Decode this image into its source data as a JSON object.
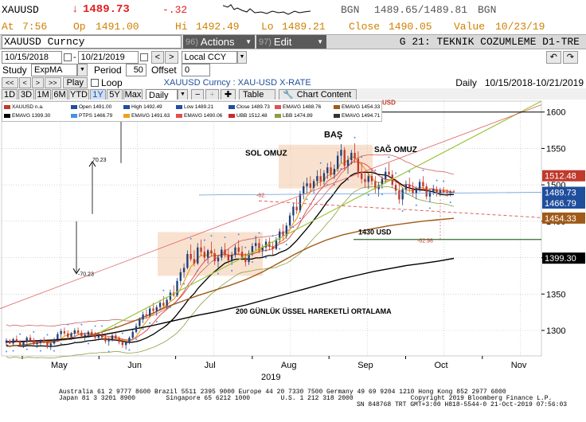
{
  "ticker_row": {
    "ticker": "XAUUSD",
    "arrow": "↓",
    "last": "1489.73",
    "change": "-.32",
    "bgn_label": "BGN",
    "bidask": "1489.65/1489.81",
    "bgn_label2": "BGN"
  },
  "quote_row": {
    "at_label": "At",
    "at_value": "7:56",
    "op_label": "Op",
    "op_value": "1491.00",
    "hi_label": "Hi",
    "hi_value": "1492.49",
    "lo_label": "Lo",
    "lo_value": "1489.21",
    "close_label": "Close",
    "close_value": "1490.05",
    "value_label": "Value",
    "value_value": "10/23/19"
  },
  "title_bar": {
    "security": "XAUUSD  Curncy",
    "actions_num": "96)",
    "actions_label": "Actions",
    "edit_num": "97)",
    "edit_label": "Edit",
    "page_title": "G 21: TEKNIK COZUMLEME D1-TRE"
  },
  "date_row": {
    "start_date": "10/15/2018",
    "end_date": "10/21/2019",
    "currency": "Local CCY"
  },
  "study_row": {
    "study_label": "Study",
    "study_value": "ExpMA",
    "period_label": "Period",
    "period_value": "50",
    "offset_label": "Offset",
    "offset_value": "0"
  },
  "play_row": {
    "play_label": "Play",
    "loop_label": "Loop",
    "chart_desc": "XAUUSD  Curncy : XAU-USD X-RATE",
    "freq_label": "Daily",
    "range_label": "10/15/2018-10/21/2019"
  },
  "period_row": {
    "buttons": [
      "1D",
      "3D",
      "1M",
      "6M",
      "YTD",
      "1Y",
      "5Y",
      "Max"
    ],
    "selected": "1Y",
    "freq_select": "Daily",
    "table_label": "Table",
    "chart_content_label": "Chart Content"
  },
  "legend": [
    {
      "label": "XAUUSD  n.a.",
      "color": "#c0392b"
    },
    {
      "label": "Open 1491.00",
      "color": "#1f4e9c"
    },
    {
      "label": "High 1492.49",
      "color": "#1f4e9c"
    },
    {
      "label": "Low 1489.21",
      "color": "#1f4e9c"
    },
    {
      "label": "Close 1489.73",
      "color": "#1f4e9c"
    },
    {
      "label": "EMAVG 1488.76",
      "color": "#e05050"
    },
    {
      "label": "EMAVG 1454.33",
      "color": "#a05a1a"
    },
    {
      "label": "EMAVG 1399.30",
      "color": "#000000"
    },
    {
      "label": "PTPS 1466.79",
      "color": "#4a90e2"
    },
    {
      "label": "EMAVG 1491.63",
      "color": "#f0a020"
    },
    {
      "label": "EMAVG 1490.06",
      "color": "#e05050"
    },
    {
      "label": "UBB 1512.48",
      "color": "#c03030"
    },
    {
      "label": "LBB 1474.89",
      "color": "#8aa040"
    },
    {
      "label": "EMAVG 1494.71",
      "color": "#333333"
    }
  ],
  "chart_data": {
    "type": "candlestick",
    "x_ticks": [
      "May",
      "Jun",
      "Jul",
      "Aug",
      "Sep",
      "Oct",
      "Nov"
    ],
    "x_year": "2019",
    "y_ticks": [
      1300,
      1350,
      1400,
      1450,
      1500,
      1550,
      1600
    ],
    "ylim": [
      1265,
      1615
    ],
    "right_labels": [
      {
        "value": "1512.48",
        "color": "#c0392b"
      },
      {
        "value": "1489.73",
        "color": "#1f4e9c"
      },
      {
        "value": "1466.79",
        "color": "#1f4e9c"
      },
      {
        "value": "1454.33",
        "color": "#a05a1a"
      },
      {
        "value": "1399.30",
        "color": "#000000"
      }
    ],
    "annotations": {
      "head": "BAŞ",
      "left_shoulder": "SOL OMUZ",
      "right_shoulder": "SAĞ OMUZ",
      "support": "1430 USD",
      "ema200": "200 GÜNLÜK ÜSSEL HAREKETLİ ORTALAMA",
      "target_up": "70.23",
      "target_down": "-70.23",
      "neck_drop": "-62.98",
      "neck_left": "-62.",
      "usd_tag": "USD"
    },
    "series": [
      {
        "name": "XAUUSD",
        "candles": [
          [
            1283,
            1289,
            1279,
            1286
          ],
          [
            1286,
            1288,
            1281,
            1282
          ],
          [
            1282,
            1290,
            1280,
            1288
          ],
          [
            1288,
            1293,
            1284,
            1285
          ],
          [
            1285,
            1287,
            1278,
            1280
          ],
          [
            1280,
            1286,
            1276,
            1284
          ],
          [
            1284,
            1292,
            1282,
            1290
          ],
          [
            1290,
            1294,
            1283,
            1286
          ],
          [
            1286,
            1290,
            1279,
            1281
          ],
          [
            1281,
            1285,
            1276,
            1283
          ],
          [
            1283,
            1288,
            1280,
            1287
          ],
          [
            1287,
            1291,
            1282,
            1284
          ],
          [
            1284,
            1286,
            1275,
            1278
          ],
          [
            1278,
            1284,
            1273,
            1282
          ],
          [
            1282,
            1290,
            1280,
            1288
          ],
          [
            1288,
            1298,
            1285,
            1295
          ],
          [
            1295,
            1302,
            1290,
            1299
          ],
          [
            1299,
            1304,
            1293,
            1296
          ],
          [
            1296,
            1300,
            1288,
            1291
          ],
          [
            1291,
            1298,
            1287,
            1296
          ],
          [
            1296,
            1303,
            1292,
            1300
          ],
          [
            1300,
            1304,
            1294,
            1297
          ],
          [
            1297,
            1300,
            1289,
            1292
          ],
          [
            1292,
            1297,
            1286,
            1294
          ],
          [
            1294,
            1300,
            1290,
            1298
          ],
          [
            1298,
            1302,
            1292,
            1294
          ],
          [
            1294,
            1298,
            1287,
            1290
          ],
          [
            1290,
            1296,
            1286,
            1293
          ],
          [
            1293,
            1298,
            1288,
            1290
          ],
          [
            1290,
            1294,
            1282,
            1285
          ],
          [
            1285,
            1290,
            1279,
            1288
          ],
          [
            1288,
            1296,
            1285,
            1293
          ],
          [
            1293,
            1297,
            1286,
            1289
          ],
          [
            1289,
            1292,
            1281,
            1284
          ],
          [
            1284,
            1288,
            1276,
            1280
          ],
          [
            1280,
            1286,
            1274,
            1283
          ],
          [
            1283,
            1292,
            1281,
            1290
          ],
          [
            1290,
            1301,
            1288,
            1298
          ],
          [
            1298,
            1310,
            1296,
            1306
          ],
          [
            1306,
            1318,
            1302,
            1315
          ],
          [
            1315,
            1326,
            1310,
            1322
          ],
          [
            1322,
            1329,
            1316,
            1320
          ],
          [
            1320,
            1334,
            1318,
            1330
          ],
          [
            1330,
            1338,
            1324,
            1327
          ],
          [
            1327,
            1335,
            1320,
            1332
          ],
          [
            1332,
            1342,
            1328,
            1338
          ],
          [
            1338,
            1347,
            1332,
            1334
          ],
          [
            1334,
            1345,
            1330,
            1342
          ],
          [
            1342,
            1356,
            1340,
            1352
          ],
          [
            1352,
            1362,
            1346,
            1348
          ],
          [
            1348,
            1372,
            1346,
            1368
          ],
          [
            1368,
            1385,
            1362,
            1380
          ],
          [
            1380,
            1392,
            1372,
            1386
          ],
          [
            1386,
            1410,
            1384,
            1405
          ],
          [
            1405,
            1418,
            1395,
            1398
          ],
          [
            1398,
            1410,
            1388,
            1392
          ],
          [
            1392,
            1420,
            1390,
            1414
          ],
          [
            1414,
            1425,
            1402,
            1408
          ],
          [
            1408,
            1416,
            1395,
            1400
          ],
          [
            1400,
            1412,
            1392,
            1410
          ],
          [
            1410,
            1422,
            1402,
            1406
          ],
          [
            1406,
            1412,
            1390,
            1395
          ],
          [
            1395,
            1404,
            1386,
            1400
          ],
          [
            1400,
            1415,
            1396,
            1411
          ],
          [
            1411,
            1420,
            1400,
            1404
          ],
          [
            1404,
            1412,
            1392,
            1396
          ],
          [
            1396,
            1408,
            1390,
            1404
          ],
          [
            1404,
            1418,
            1400,
            1414
          ],
          [
            1414,
            1424,
            1405,
            1408
          ],
          [
            1408,
            1416,
            1396,
            1400
          ],
          [
            1400,
            1406,
            1388,
            1394
          ],
          [
            1394,
            1410,
            1390,
            1406
          ],
          [
            1406,
            1420,
            1402,
            1416
          ],
          [
            1416,
            1430,
            1410,
            1420
          ],
          [
            1420,
            1426,
            1406,
            1410
          ],
          [
            1410,
            1418,
            1400,
            1414
          ],
          [
            1414,
            1426,
            1408,
            1422
          ],
          [
            1422,
            1428,
            1410,
            1415
          ],
          [
            1415,
            1422,
            1404,
            1412
          ],
          [
            1412,
            1428,
            1410,
            1425
          ],
          [
            1425,
            1440,
            1420,
            1436
          ],
          [
            1436,
            1446,
            1424,
            1430
          ],
          [
            1430,
            1448,
            1426,
            1444
          ],
          [
            1444,
            1462,
            1440,
            1458
          ],
          [
            1458,
            1475,
            1450,
            1470
          ],
          [
            1470,
            1482,
            1460,
            1465
          ],
          [
            1465,
            1492,
            1462,
            1488
          ],
          [
            1488,
            1504,
            1480,
            1498
          ],
          [
            1498,
            1510,
            1488,
            1502
          ],
          [
            1502,
            1512,
            1490,
            1496
          ],
          [
            1496,
            1508,
            1488,
            1505
          ],
          [
            1505,
            1520,
            1498,
            1512
          ],
          [
            1512,
            1522,
            1498,
            1505
          ],
          [
            1505,
            1520,
            1500,
            1516
          ],
          [
            1516,
            1530,
            1508,
            1524
          ],
          [
            1524,
            1532,
            1510,
            1514
          ],
          [
            1514,
            1528,
            1508,
            1522
          ],
          [
            1522,
            1546,
            1518,
            1540
          ],
          [
            1540,
            1556,
            1530,
            1548
          ],
          [
            1548,
            1552,
            1520,
            1526
          ],
          [
            1526,
            1540,
            1515,
            1534
          ],
          [
            1534,
            1548,
            1528,
            1544
          ],
          [
            1544,
            1557,
            1530,
            1536
          ],
          [
            1536,
            1546,
            1510,
            1516
          ],
          [
            1516,
            1530,
            1502,
            1508
          ],
          [
            1508,
            1518,
            1496,
            1504
          ],
          [
            1504,
            1516,
            1494,
            1512
          ],
          [
            1512,
            1522,
            1500,
            1505
          ],
          [
            1505,
            1512,
            1488,
            1494
          ],
          [
            1494,
            1504,
            1484,
            1500
          ],
          [
            1500,
            1512,
            1495,
            1508
          ],
          [
            1508,
            1524,
            1502,
            1518
          ],
          [
            1518,
            1530,
            1510,
            1514
          ],
          [
            1514,
            1520,
            1496,
            1500
          ],
          [
            1500,
            1508,
            1486,
            1492
          ],
          [
            1492,
            1504,
            1474,
            1480
          ],
          [
            1480,
            1496,
            1472,
            1494
          ],
          [
            1494,
            1506,
            1488,
            1500
          ],
          [
            1500,
            1510,
            1490,
            1496
          ],
          [
            1496,
            1504,
            1484,
            1488
          ],
          [
            1488,
            1498,
            1480,
            1495
          ],
          [
            1495,
            1508,
            1490,
            1504
          ],
          [
            1504,
            1512,
            1492,
            1498
          ],
          [
            1498,
            1502,
            1480,
            1484
          ],
          [
            1484,
            1494,
            1476,
            1490
          ],
          [
            1490,
            1500,
            1486,
            1494
          ],
          [
            1494,
            1498,
            1484,
            1488
          ],
          [
            1488,
            1496,
            1484,
            1492
          ],
          [
            1492,
            1497,
            1486,
            1490
          ],
          [
            1490,
            1494,
            1484,
            1489
          ],
          [
            1489,
            1493,
            1484,
            1490
          ],
          [
            1491,
            1493,
            1489,
            1490
          ]
        ]
      },
      {
        "name": "EMAVG",
        "color": "#000000",
        "values": [
          1289,
          1290,
          1292,
          1293,
          1296,
          1300,
          1312,
          1325,
          1340,
          1360,
          1380,
          1395,
          1405,
          1410,
          1418,
          1428,
          1445,
          1465,
          1482,
          1492,
          1500,
          1504,
          1502,
          1498,
          1496,
          1494,
          1493,
          1492,
          1492
        ]
      },
      {
        "name": "EMAVG",
        "color": "#a05a1a",
        "values": [
          1278,
          1280,
          1283,
          1286,
          1288,
          1292,
          1298,
          1305,
          1313,
          1322,
          1332,
          1340,
          1348,
          1355,
          1362,
          1370,
          1380,
          1392,
          1404,
          1415,
          1424,
          1431,
          1436,
          1440,
          1444,
          1447,
          1450,
          1452,
          1454
        ]
      },
      {
        "name": "EMAVG",
        "color": "#000000",
        "values": [
          1284,
          1285,
          1286,
          1287,
          1289,
          1291,
          1294,
          1298,
          1302,
          1306,
          1311,
          1316,
          1321,
          1325,
          1330,
          1335,
          1341,
          1347,
          1353,
          1359,
          1365,
          1371,
          1376,
          1381,
          1385,
          1389,
          1392,
          1395,
          1399
        ]
      }
    ]
  },
  "footer": {
    "line1": "Australia 61 2 9777 8600 Brazil 5511 2395 9000 Europe 44 20 7330 7500 Germany 49 69 9204 1210 Hong Kong 852 2977 6000",
    "line2": "Japan 81 3 3201 8900        Singapore 65 6212 1000        U.S. 1 212 318 2000               Copyright 2019 Bloomberg Finance L.P.",
    "line3": "SN 848768 TRT  GMT+3:00 H818-5544-0 21-Oct-2019 07:56:03"
  }
}
